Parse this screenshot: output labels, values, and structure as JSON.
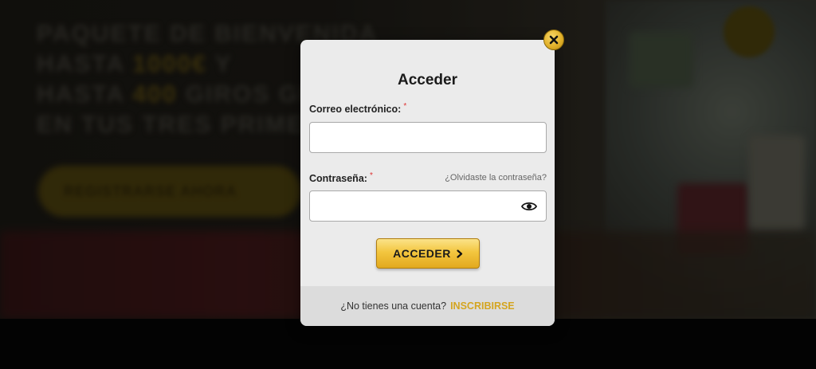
{
  "modal": {
    "title": "Acceder",
    "email": {
      "label": "Correo electrónico:",
      "required_mark": "*",
      "value": "",
      "placeholder": ""
    },
    "password": {
      "label": "Contraseña:",
      "required_mark": "*",
      "value": "",
      "placeholder": "",
      "forgot_link": "¿Olvidaste la contraseña?",
      "toggle_icon": "eye-icon"
    },
    "submit_label": "ACCEDER",
    "footer": {
      "question": "¿No tienes una cuenta?",
      "signup_link": "INSCRIBIRSE"
    },
    "close_icon": "close-icon"
  },
  "colors": {
    "accent_gold": "#f3c63f",
    "link_gold": "#d4a520",
    "modal_bg": "#ebebeb",
    "footer_bg": "#dcdcdc",
    "required_red": "#dd3333"
  }
}
